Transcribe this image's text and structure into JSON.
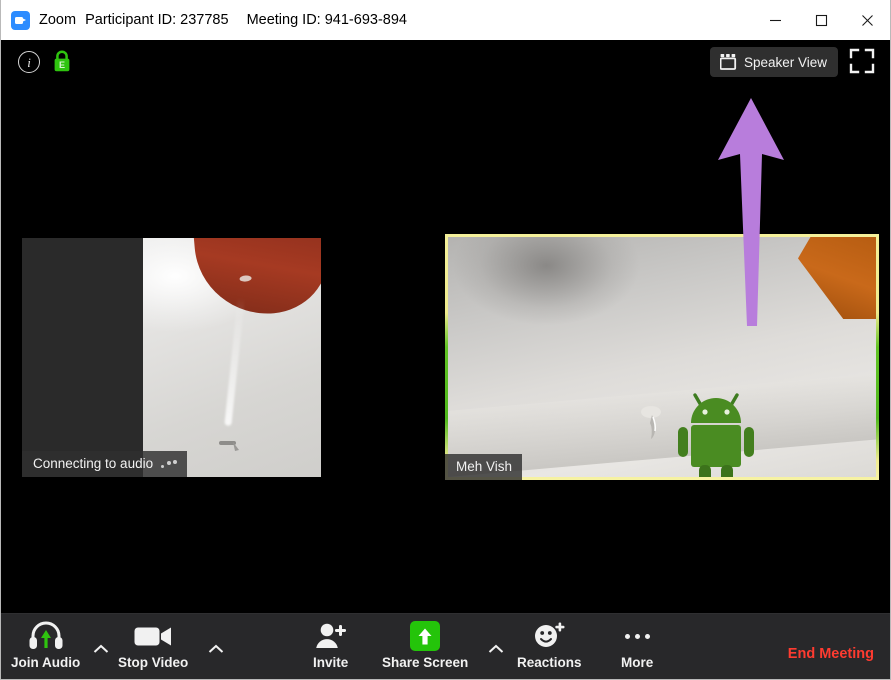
{
  "window": {
    "title_app": "Zoom",
    "title_participant": "Participant ID: 237785",
    "title_meeting": "Meeting ID: 941-693-894",
    "logo_icon": "zoom-logo-icon",
    "controls": {
      "minimize": "minimize-icon",
      "maximize": "maximize-icon",
      "close": "close-icon"
    }
  },
  "stage": {
    "info_icon": "info-icon",
    "info_glyph": "i",
    "encryption_icon": "green-lock-icon",
    "encryption_letter": "E",
    "view_button": {
      "label": "Speaker View",
      "icon": "gallery-view-icon"
    },
    "fullscreen_button": {
      "icon": "enter-fullscreen-icon"
    },
    "annotation": {
      "icon": "purple-up-arrow-icon",
      "color": "#b87ddc"
    }
  },
  "participants": [
    {
      "name": "Connecting to audio",
      "status_icon": "loading-dots-icon",
      "active_speaker": false,
      "video_on": true
    },
    {
      "name": "Meh Vish",
      "active_speaker": true,
      "video_on": true,
      "border_color": "#eeea8f"
    }
  ],
  "toolbar": {
    "items": [
      {
        "label": "Join Audio",
        "icon": "headset-join-audio-icon",
        "has_caret": true
      },
      {
        "label": "Stop Video",
        "icon": "video-camera-icon",
        "has_caret": true
      },
      {
        "label": "Invite",
        "icon": "invite-person-plus-icon",
        "has_caret": false
      },
      {
        "label": "Share Screen",
        "icon": "share-screen-up-arrow-icon",
        "has_caret": true
      },
      {
        "label": "Reactions",
        "icon": "smiley-plus-icon",
        "has_caret": false
      },
      {
        "label": "More",
        "icon": "more-dots-icon",
        "has_caret": false
      }
    ],
    "end_meeting": {
      "label": "End Meeting",
      "color": "#ff3b30"
    }
  }
}
